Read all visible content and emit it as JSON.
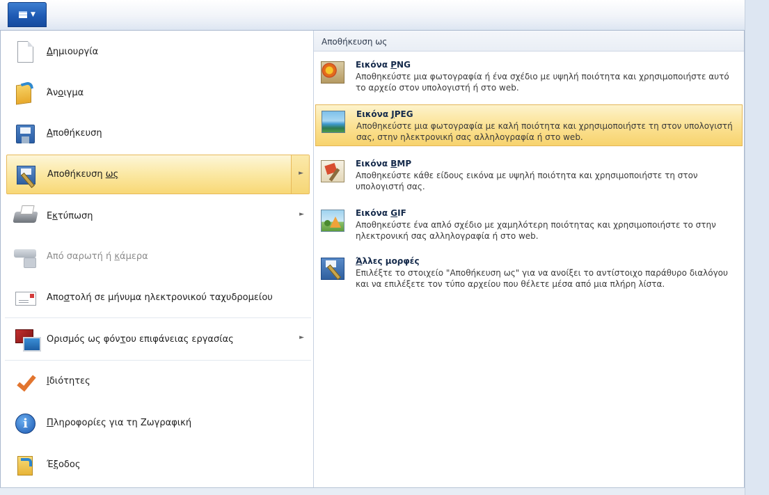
{
  "left_menu": {
    "items": [
      {
        "pre": "",
        "key": "Δ",
        "post": "ημιουργία",
        "icon": "new-document-icon",
        "submenu": false,
        "disabled": false
      },
      {
        "pre": "Άν",
        "key": "ο",
        "post": "ιγμα",
        "icon": "open-folder-icon",
        "submenu": false,
        "disabled": false
      },
      {
        "pre": "",
        "key": "Α",
        "post": "ποθήκευση",
        "icon": "save-disk-icon",
        "submenu": false,
        "disabled": false
      },
      {
        "pre": "Αποθήκευση ",
        "key": "ως",
        "post": "",
        "icon": "save-as-icon",
        "submenu": true,
        "disabled": false
      },
      {
        "pre": "Ε",
        "key": "κ",
        "post": "τύπωση",
        "icon": "printer-icon",
        "submenu": true,
        "disabled": false
      },
      {
        "pre": "Από σαρωτή ή ",
        "key": "κ",
        "post": "άμερα",
        "icon": "scanner-icon",
        "submenu": false,
        "disabled": true
      },
      {
        "pre": "Απο",
        "key": "σ",
        "post": "τολή σε μήνυμα ηλεκτρονικού ταχυδρομείου",
        "icon": "email-icon",
        "submenu": false,
        "disabled": false
      },
      {
        "pre": "Ορισμός ως φόν",
        "key": "τ",
        "post": "ου επιφάνειας εργασίας",
        "icon": "desktop-background-icon",
        "submenu": true,
        "disabled": false
      },
      {
        "pre": "",
        "key": "Ι",
        "post": "διότητες",
        "icon": "checkmark-icon",
        "submenu": false,
        "disabled": false
      },
      {
        "pre": "",
        "key": "Π",
        "post": "ληροφορίες για τη Ζωγραφική",
        "icon": "info-icon",
        "submenu": false,
        "disabled": false
      },
      {
        "pre": "Έ",
        "key": "ξ",
        "post": "οδος",
        "icon": "exit-icon",
        "submenu": false,
        "disabled": false
      }
    ],
    "active_index": 3
  },
  "submenu": {
    "header": "Αποθήκευση ως",
    "options": [
      {
        "title_pre": "Εικόνα ",
        "title_key": "P",
        "title_post": "NG",
        "desc": "Αποθηκεύστε μια φωτογραφία ή ένα σχέδιο με υψηλή ποιότητα και χρησιμοποιήστε αυτό το αρχείο στον υπολογιστή ή στο web.",
        "icon": "png-image-icon"
      },
      {
        "title_pre": "Εικόνα ",
        "title_key": "J",
        "title_post": "PEG",
        "desc": "Αποθηκεύστε μια φωτογραφία με καλή ποιότητα και χρησιμοποιήστε τη στον υπολογιστή σας, στην ηλεκτρονική σας αλληλογραφία ή στο web.",
        "icon": "jpeg-image-icon"
      },
      {
        "title_pre": "Εικόνα ",
        "title_key": "B",
        "title_post": "MP",
        "desc": "Αποθηκεύστε κάθε είδους εικόνα με υψηλή ποιότητα και χρησιμοποιήστε τη στον υπολογιστή σας.",
        "icon": "bmp-image-icon"
      },
      {
        "title_pre": "Εικόνα ",
        "title_key": "G",
        "title_post": "IF",
        "desc": "Αποθηκεύστε ένα απλό σχέδιο με χαμηλότερη ποιότητας και χρησιμοποιήστε το στην ηλεκτρονική σας αλληλογραφία ή στο web.",
        "icon": "gif-image-icon"
      },
      {
        "title_pre": "",
        "title_key": "Ά",
        "title_post": "λλες μορφές",
        "desc": "Επιλέξτε το στοιχείο \"Αποθήκευση ως\" για να ανοίξει το αντίστοιχο παράθυρο διαλόγου και να επιλέξετε τον τύπο αρχείου που θέλετε μέσα από μια πλήρη λίστα.",
        "icon": "other-formats-icon"
      }
    ],
    "selected_index": 1
  },
  "colors": {
    "highlight": "#fbe295",
    "highlight_border": "#e4b657",
    "app_button": "#1f5bb4"
  }
}
